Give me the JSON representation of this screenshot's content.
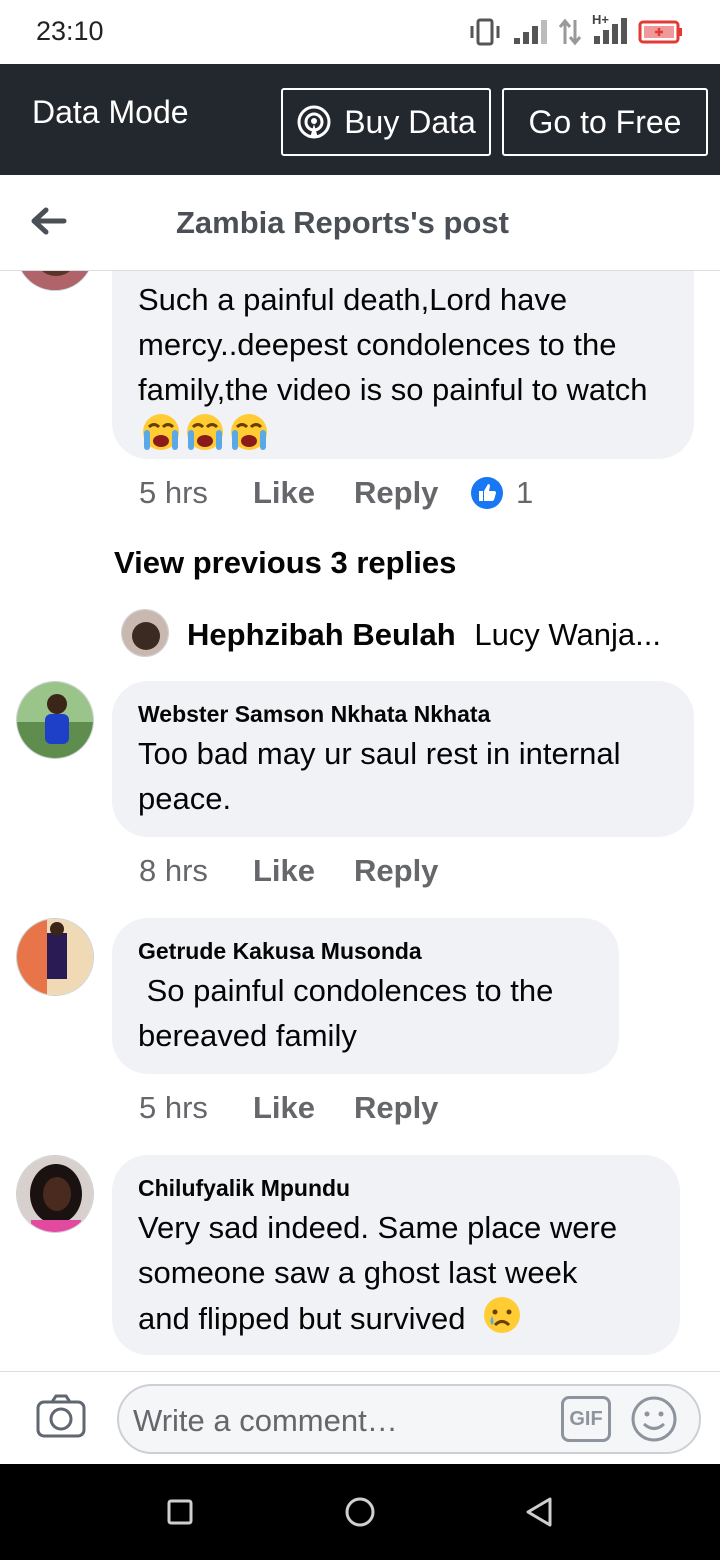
{
  "status_bar": {
    "time": "23:10",
    "network_label": "H+"
  },
  "data_bar": {
    "mode_label": "Data Mode",
    "buy_data_label": "Buy Data",
    "go_free_label": "Go to Free"
  },
  "header": {
    "title": "Zambia Reports's post"
  },
  "comments": [
    {
      "author": "",
      "text": "Such a painful death,Lord have mercy..deepest condolences to the family,the video is so painful to watch",
      "emoji": [
        "loudly-crying-face",
        "loudly-crying-face",
        "loudly-crying-face"
      ],
      "time": "5 hrs",
      "like": "Like",
      "reply": "Reply",
      "reaction_count": "1"
    },
    {
      "author": "Webster Samson Nkhata Nkhata",
      "text_line1": "Too bad may ur saul rest in internal",
      "text_line2": "peace.",
      "time": "8 hrs",
      "like": "Like",
      "reply": "Reply"
    },
    {
      "author": "Getrude Kakusa Musonda",
      "text_line1": " So painful condolences to the",
      "text_line2": "bereaved family",
      "time": "5 hrs",
      "like": "Like",
      "reply": "Reply"
    },
    {
      "author": "Chilufyalik Mpundu",
      "text_line1": "Very sad indeed. Same place were",
      "text_line2": "someone saw a ghost last week",
      "text_line3": "and flipped but survived",
      "emoji": "crying-face"
    }
  ],
  "replies_link": "View previous 3 replies",
  "reply_preview": {
    "author": "Hephzibah Beulah",
    "text": "Lucy Wanja..."
  },
  "composer": {
    "placeholder": "Write a comment…",
    "gif_label": "GIF"
  },
  "colors": {
    "data_bar": "#23272e",
    "bubble": "#f0f2f5",
    "like_blue": "#1877f2",
    "meta_grey": "#65676b"
  }
}
